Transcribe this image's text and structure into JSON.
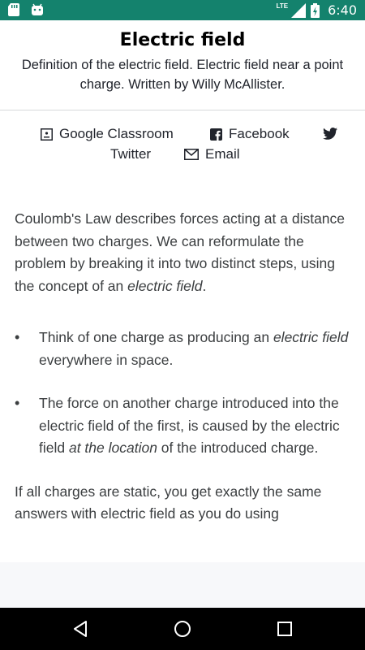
{
  "status_bar": {
    "time": "6:40",
    "network": "LTE",
    "icons": [
      "sd-card-icon",
      "android-icon",
      "signal-icon",
      "battery-icon"
    ]
  },
  "article": {
    "title": "Electric field",
    "subtitle": "Definition of the electric field. Electric field near a point charge. Written by Willy McAllister."
  },
  "share": {
    "google_classroom": "Google Classroom",
    "facebook": "Facebook",
    "twitter": "Twitter",
    "email": "Email"
  },
  "content": {
    "p1_text": "Coulomb's Law describes forces acting at a distance between two charges. We can reformulate the problem by breaking it into two distinct steps, using the concept of an ",
    "p1_em": "electric field",
    "p1_end": ".",
    "bullet1_text": "Think of one charge as producing an ",
    "bullet1_em": "electric field",
    "bullet1_end": " everywhere in space.",
    "bullet2_text": "The force on another charge introduced into the electric field of the first, is caused by the electric field ",
    "bullet2_em": "at the location",
    "bullet2_end": " of the introduced charge.",
    "p2_text": "If all charges are static, you get exactly the same answers with electric field as you do using"
  },
  "colors": {
    "status_bar": "#14826d",
    "text": "#21242c",
    "body_text": "#3b3e40"
  }
}
